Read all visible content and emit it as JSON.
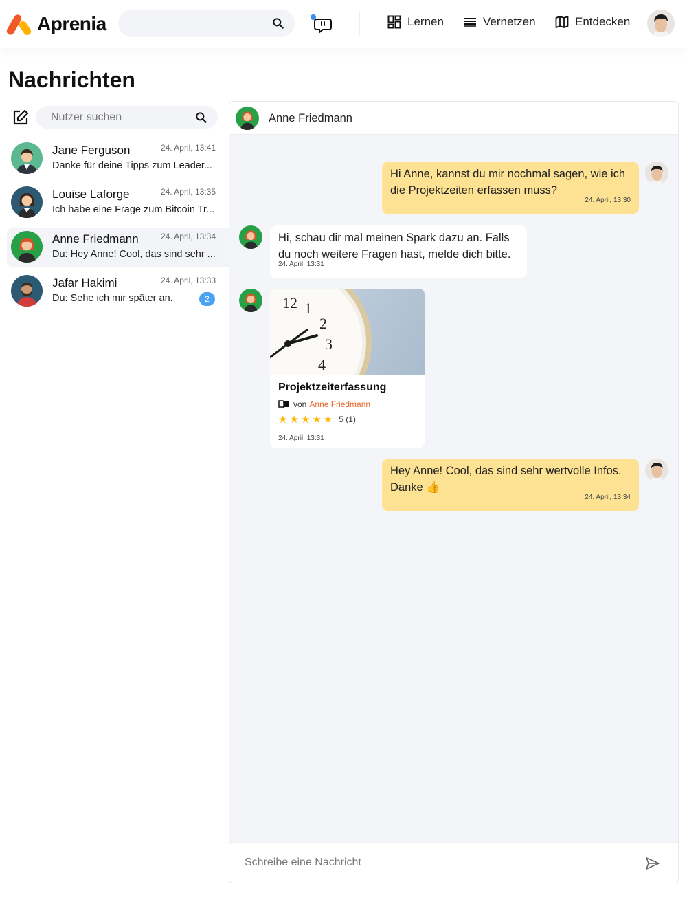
{
  "header": {
    "app_name": "Aprenia",
    "search_placeholder": "",
    "nav": [
      {
        "label": "Lernen",
        "icon": "dashboard-icon"
      },
      {
        "label": "Vernetzen",
        "icon": "list-icon"
      },
      {
        "label": "Entdecken",
        "icon": "map-icon"
      }
    ]
  },
  "page": {
    "title": "Nachrichten"
  },
  "sidebar": {
    "search_placeholder": "Nutzer suchen",
    "conversations": [
      {
        "name": "Jane Ferguson",
        "time": "24. April, 13:41",
        "preview": "Danke für deine Tipps zum Leader...",
        "active": false,
        "unread": null
      },
      {
        "name": "Louise Laforge",
        "time": "24. April, 13:35",
        "preview": "Ich habe eine Frage zum Bitcoin Tr...",
        "active": false,
        "unread": null
      },
      {
        "name": "Anne Friedmann",
        "time": "24. April, 13:34",
        "preview": "Du: Hey Anne! Cool, das sind sehr ...",
        "active": true,
        "unread": null
      },
      {
        "name": "Jafar Hakimi",
        "time": "24. April, 13:33",
        "preview": "Du: Sehe ich mir später an.",
        "active": false,
        "unread": "2"
      }
    ]
  },
  "chat": {
    "contact_name": "Anne Friedmann",
    "messages": [
      {
        "from": "me",
        "text": "Hi Anne, kannst du mir nochmal sagen, wie ich die Projektzeiten erfassen muss?",
        "time": "24. April, 13:30"
      },
      {
        "from": "them",
        "text": "Hi, schau dir mal meinen Spark dazu an. Falls du noch weitere Fragen hast, melde dich bitte.",
        "time": "24. April, 13:31"
      },
      {
        "from": "them",
        "type": "card",
        "card": {
          "title": "Projektzeiterfassung",
          "by_prefix": "von",
          "author": "Anne Friedmann",
          "stars": "★★★★★",
          "rating": "5 (1)",
          "time": "24. April, 13:31"
        }
      },
      {
        "from": "me",
        "text": "Hey Anne! Cool, das sind sehr wertvolle Infos. Danke 👍",
        "time": "24. April, 13:34"
      }
    ],
    "composer_placeholder": "Schreibe eine Nachricht"
  },
  "colors": {
    "accent_orange": "#f05a28",
    "accent_yellow": "#ffb000",
    "my_bubble": "#fde293",
    "badge_blue": "#4aa3f2",
    "star": "#ffb400"
  }
}
